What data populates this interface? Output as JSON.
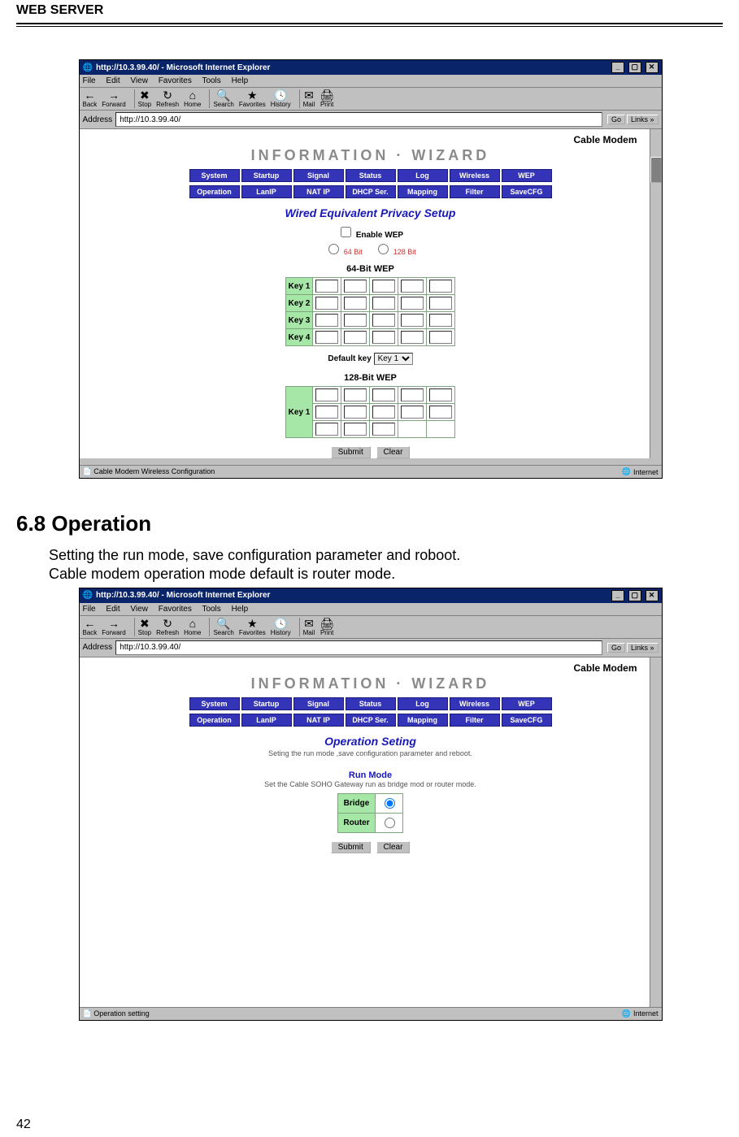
{
  "doc": {
    "running_head": "WEB SERVER",
    "heading": "6.8 Operation",
    "body_line1": "Setting the run mode, save configuration parameter and roboot.",
    "body_line2": "Cable modem operation mode default is router mode.",
    "page_no": "42"
  },
  "browser": {
    "title": "http://10.3.99.40/ - Microsoft Internet Explorer",
    "menus": [
      "File",
      "Edit",
      "View",
      "Favorites",
      "Tools",
      "Help"
    ],
    "tool_buttons": [
      "Back",
      "Forward",
      "Stop",
      "Refresh",
      "Home",
      "Search",
      "Favorites",
      "History",
      "Mail",
      "Print"
    ],
    "address_label": "Address",
    "address_value": "http://10.3.99.40/",
    "go_label": "Go",
    "links_label": "Links »",
    "zone_label": "Internet"
  },
  "shot1": {
    "brand": "Cable Modem",
    "wizard": "INFORMATION  ·  WIZARD",
    "nav_top": [
      "System",
      "Startup",
      "Signal",
      "Status",
      "Log",
      "Wireless",
      "WEP"
    ],
    "nav_bottom": [
      "Operation",
      "LanIP",
      "NAT IP",
      "DHCP Ser.",
      "Mapping",
      "Filter",
      "SaveCFG"
    ],
    "section_title": "Wired Equivalent Privacy Setup",
    "enable_label": "Enable WEP",
    "radio_64": "64 Bit",
    "radio_128": "128 Bit",
    "wep64_label": "64-Bit WEP",
    "keys64": [
      "Key 1",
      "Key 2",
      "Key 3",
      "Key 4"
    ],
    "default_key_label": "Default key",
    "default_key_value": "Key 1",
    "wep128_label": "128-Bit WEP",
    "key128": "Key 1",
    "submit": "Submit",
    "clear": "Clear",
    "status_text": "Cable Modem Wireless Configuration"
  },
  "shot2": {
    "brand": "Cable Modem",
    "wizard": "INFORMATION  ·  WIZARD",
    "nav_top": [
      "System",
      "Startup",
      "Signal",
      "Status",
      "Log",
      "Wireless",
      "WEP"
    ],
    "nav_bottom": [
      "Operation",
      "LanIP",
      "NAT IP",
      "DHCP Ser.",
      "Mapping",
      "Filter",
      "SaveCFG"
    ],
    "section_title": "Operation Seting",
    "section_sub": "Seting the run mode ,save configuration parameter and reboot.",
    "run_mode_title": "Run Mode",
    "run_mode_sub": "Set the Cable SOHO Gateway run as bridge mod or router mode.",
    "rows": [
      {
        "label": "Bridge",
        "checked": true
      },
      {
        "label": "Router",
        "checked": false
      }
    ],
    "submit": "Submit",
    "clear": "Clear",
    "status_text": "Operation setting"
  }
}
